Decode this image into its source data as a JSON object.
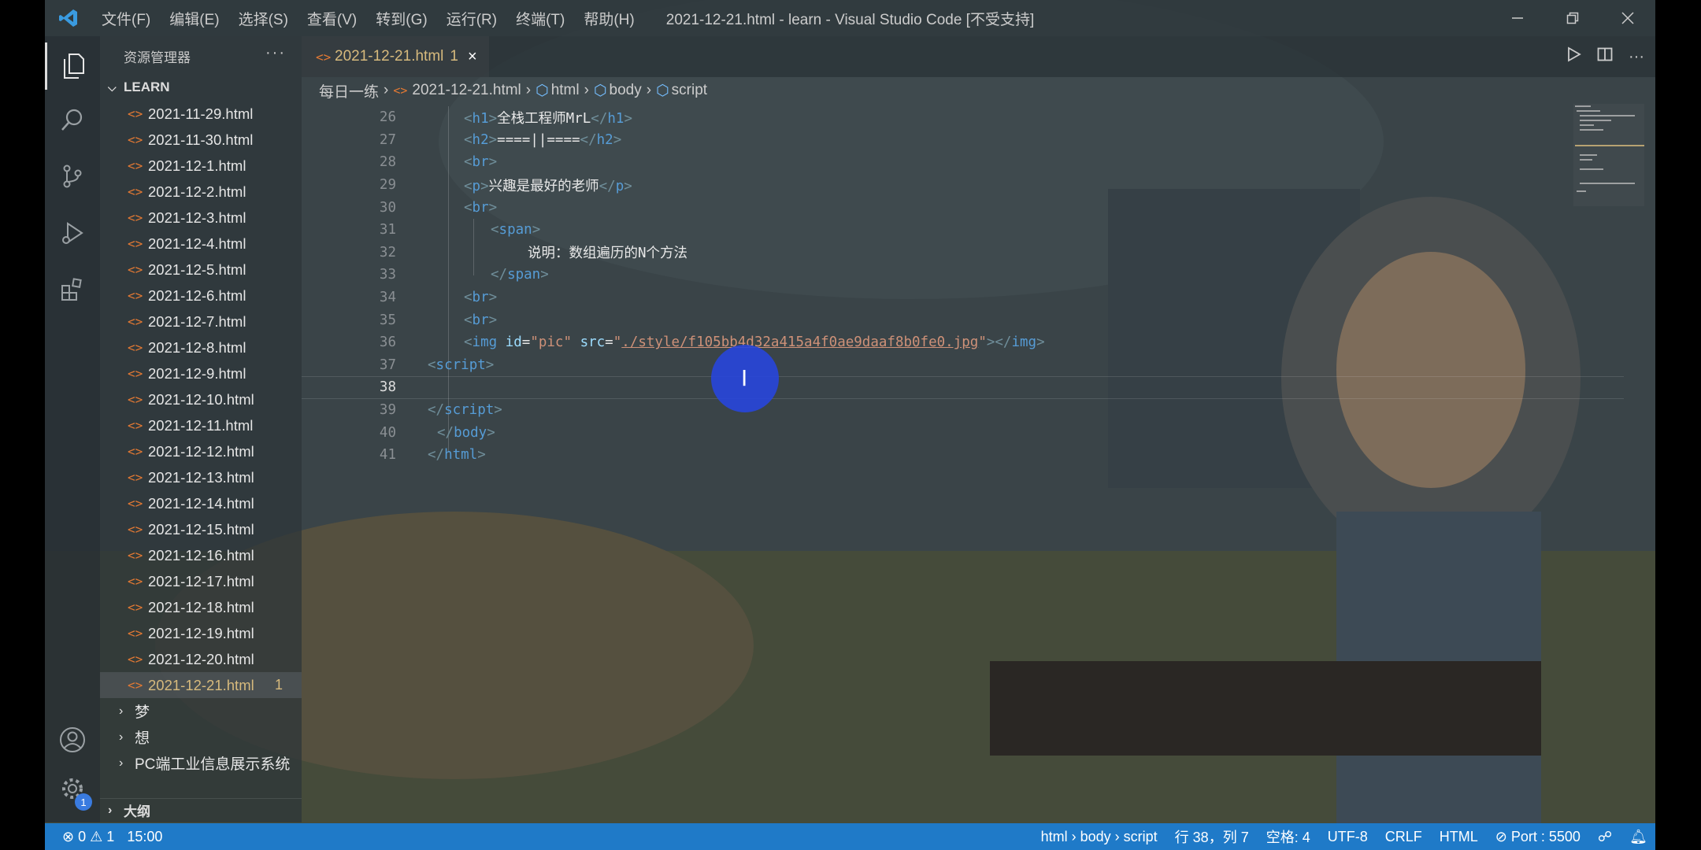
{
  "titlebar": {
    "menu": [
      "文件(F)",
      "编辑(E)",
      "选择(S)",
      "查看(V)",
      "转到(G)",
      "运行(R)",
      "终端(T)",
      "帮助(H)"
    ],
    "title": "2021-12-21.html - learn - Visual Studio Code [不受支持]"
  },
  "sidebar": {
    "header": "资源管理器",
    "more": "···",
    "section": "LEARN",
    "files": [
      "2021-11-29.html",
      "2021-11-30.html",
      "2021-12-1.html",
      "2021-12-2.html",
      "2021-12-3.html",
      "2021-12-4.html",
      "2021-12-5.html",
      "2021-12-6.html",
      "2021-12-7.html",
      "2021-12-8.html",
      "2021-12-9.html",
      "2021-12-10.html",
      "2021-12-11.html",
      "2021-12-12.html",
      "2021-12-13.html",
      "2021-12-14.html",
      "2021-12-15.html",
      "2021-12-16.html",
      "2021-12-17.html",
      "2021-12-18.html",
      "2021-12-19.html",
      "2021-12-20.html",
      "2021-12-21.html"
    ],
    "active_file_badge": "1",
    "folders": [
      "梦",
      "想",
      "PC端工业信息展示系统"
    ],
    "outline": "大纲",
    "settings_badge": "1"
  },
  "tab": {
    "label": "2021-12-21.html",
    "badge": "1",
    "close": "×"
  },
  "breadcrumb": {
    "folder": "每日一练",
    "file": "2021-12-21.html",
    "html": "html",
    "body": "body",
    "script": "script"
  },
  "code": {
    "line_numbers": [
      "26",
      "27",
      "28",
      "29",
      "30",
      "31",
      "32",
      "33",
      "34",
      "35",
      "36",
      "37",
      "38",
      "39",
      "40",
      "41"
    ],
    "l26_text": "全栈工程师MrL",
    "l27_text": "====||====",
    "l29_text": "兴趣是最好的老师",
    "l32_text": "说明：数组遍历的N个方法",
    "l36_id": "\"pic\"",
    "l36_src": "./style/f105bb4d32a415a4f0ae9daaf8b0fe0.jpg"
  },
  "statusbar": {
    "errors": "0",
    "warnings": "1",
    "time": "15:00",
    "path": "html › body › script",
    "position": "行 38，列 7",
    "spaces": "空格: 4",
    "encoding": "UTF-8",
    "eol": "CRLF",
    "language": "HTML",
    "port": "Port : 5500"
  },
  "colors": {
    "statusbar": "#1f7ac8",
    "active_file": "#d7ba7d",
    "html_icon": "#e37933",
    "cursor_ring": "#2846dc"
  }
}
